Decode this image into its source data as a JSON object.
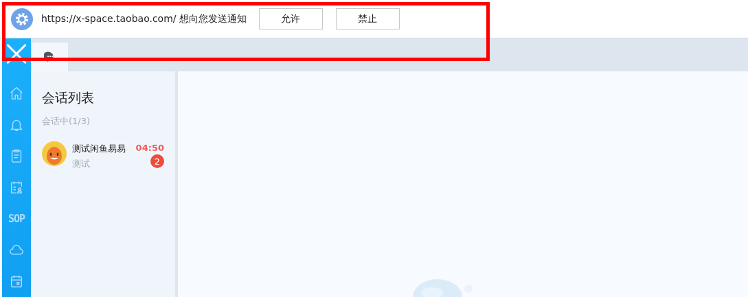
{
  "notification": {
    "message": "https://x-space.taobao.com/ 想向您发送通知",
    "buttons": [
      "允许",
      "禁止"
    ]
  },
  "sidebar": {
    "items": [
      {
        "kind": "home",
        "selected": false
      },
      {
        "kind": "bell",
        "selected": false
      },
      {
        "kind": "clipboard",
        "selected": false
      },
      {
        "kind": "schedule",
        "selected": false
      },
      {
        "kind": "text",
        "label": "SOP",
        "selected": false
      },
      {
        "kind": "cloud",
        "selected": false
      },
      {
        "kind": "calendar",
        "selected": false
      }
    ]
  },
  "tabs": [
    {
      "kind": "chat",
      "selected": true
    }
  ],
  "conversations": {
    "title": "会话列表",
    "section": "会话中(1/3)",
    "items": [
      {
        "name": "测试闲鱼易易",
        "preview": "测试",
        "time": "04:50",
        "unread": "2"
      }
    ]
  }
}
